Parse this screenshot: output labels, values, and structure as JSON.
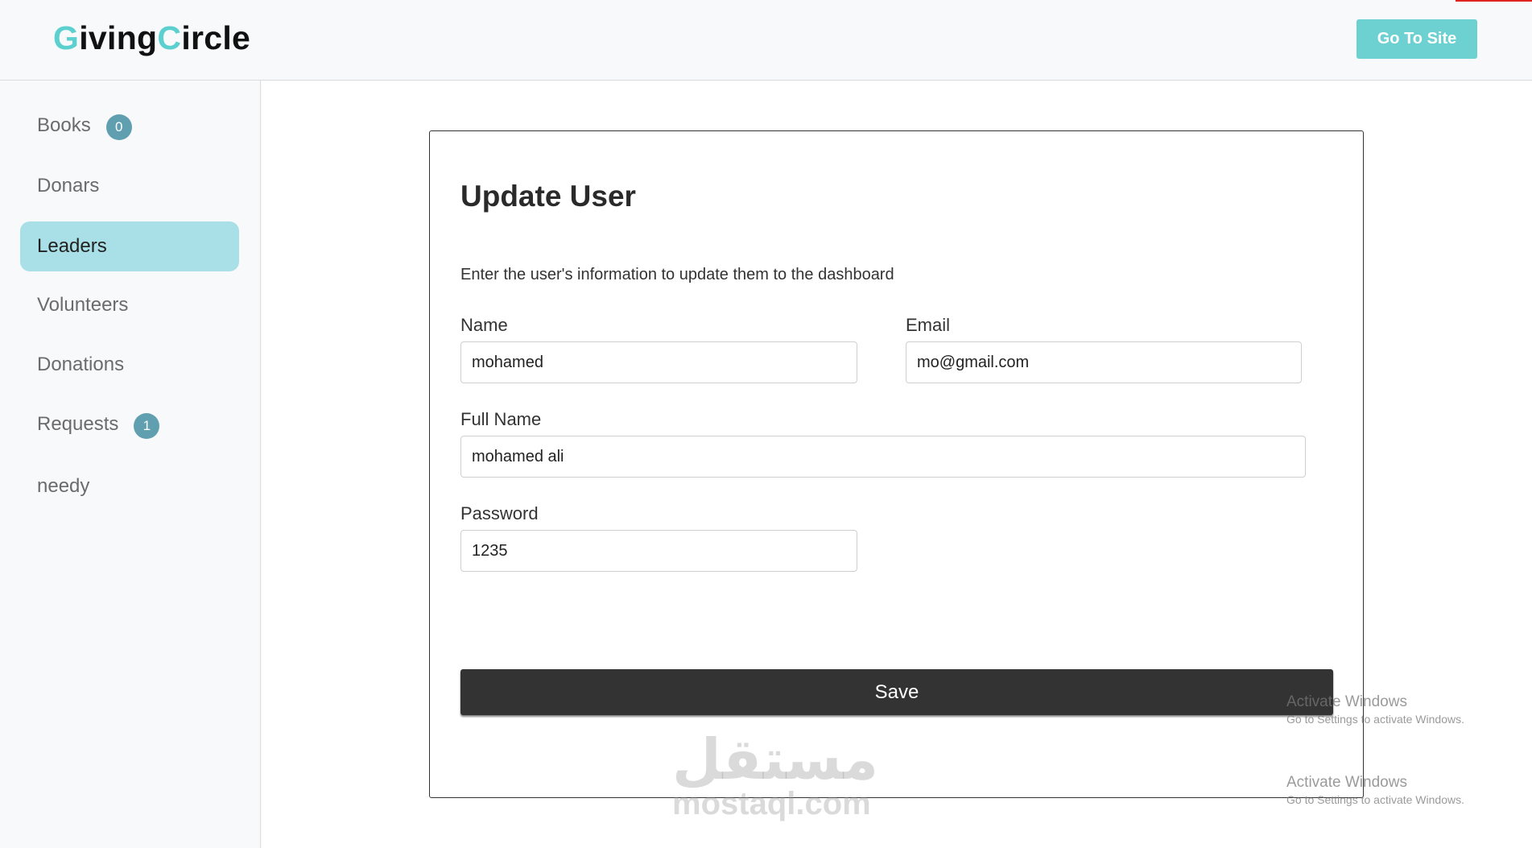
{
  "header": {
    "brand_part1_accent": "G",
    "brand_part1_rest": "iving",
    "brand_part2_accent": "C",
    "brand_part2_rest": "ircle",
    "go_to_site_label": "Go To Site"
  },
  "sidebar": {
    "items": [
      {
        "label": "Books",
        "badge": "0"
      },
      {
        "label": "Donars"
      },
      {
        "label": "Leaders",
        "active": true
      },
      {
        "label": "Volunteers"
      },
      {
        "label": "Donations"
      },
      {
        "label": "Requests",
        "badge": "1"
      },
      {
        "label": "needy"
      }
    ]
  },
  "form": {
    "title": "Update User",
    "description": "Enter the user's information to update them to the dashboard",
    "name": {
      "label": "Name",
      "value": "mohamed"
    },
    "email": {
      "label": "Email",
      "value": "mo@gmail.com"
    },
    "full_name": {
      "label": "Full Name",
      "value": "mohamed ali"
    },
    "password": {
      "label": "Password",
      "value": "1235"
    },
    "save_label": "Save"
  },
  "watermark": {
    "arabic": "مستقل",
    "latin": "mostaql.com"
  },
  "activation_notice": {
    "title": "Activate Windows",
    "subtitle": "Go to Settings to activate Windows."
  },
  "colors": {
    "accent": "#5ccfcf",
    "button_accent": "#6dd0d1",
    "active_nav": "#a9dfe6",
    "badge": "#5f9fb0",
    "save_button": "#333333"
  }
}
